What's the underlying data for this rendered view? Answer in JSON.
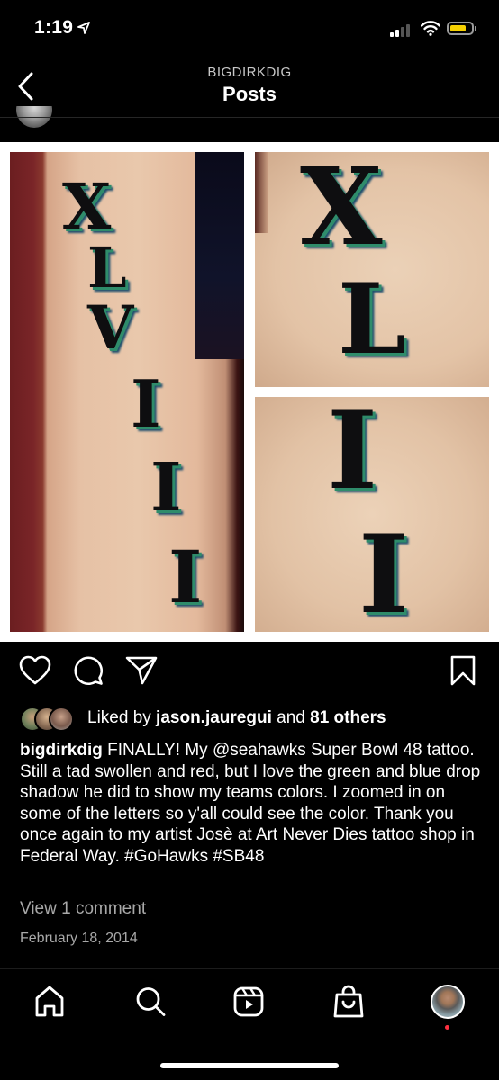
{
  "status_bar": {
    "time": "1:19"
  },
  "header": {
    "username": "BIGDIRKDIG",
    "title": "Posts"
  },
  "post": {
    "image_letters": {
      "left": [
        "X",
        "L",
        "V",
        "I",
        "I",
        "I"
      ],
      "top_right": [
        "X",
        "L"
      ],
      "bottom_right": [
        "I",
        "I"
      ]
    },
    "likes": {
      "prefix": "Liked by ",
      "user": "jason.jauregui",
      "middle": " and ",
      "others": "81 others"
    },
    "caption": {
      "username": "bigdirkdig",
      "text": " FINALLY! My @seahawks Super Bowl 48 tattoo. Still a tad swollen and red, but I love the green and blue drop shadow he did to show my teams colors. I zoomed in on some of the letters so y'all could see the color. Thank you once again to my artist Josè at Art Never Dies tattoo shop in Federal Way. #GoHawks #SB48"
    },
    "view_comments": "View 1 comment",
    "date": "February 18, 2014"
  },
  "icons": {
    "back": "chevron-left-icon",
    "like": "heart-icon",
    "comment": "comment-bubble-icon",
    "share": "paper-plane-icon",
    "save": "bookmark-icon",
    "nav": [
      "home-icon",
      "search-icon",
      "reels-icon",
      "shop-bag-icon",
      "profile-avatar"
    ]
  },
  "colors": {
    "background": "#000000",
    "secondary_text": "#a8a8a8",
    "notification_dot": "#ff3040",
    "battery": "#f5d000"
  }
}
